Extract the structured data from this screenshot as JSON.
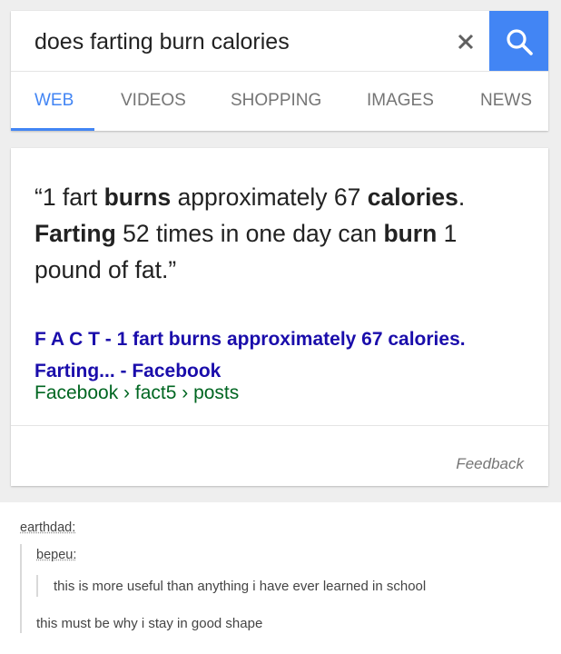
{
  "search": {
    "query": "does farting burn calories",
    "clear_symbol": "×"
  },
  "tabs": [
    {
      "label": "WEB",
      "active": true
    },
    {
      "label": "VIDEOS",
      "active": false
    },
    {
      "label": "SHOPPING",
      "active": false
    },
    {
      "label": "IMAGES",
      "active": false
    },
    {
      "label": "NEWS",
      "active": false
    }
  ],
  "snippet": {
    "quote_open": "“1 fart ",
    "quote_bold_1": "burns",
    "quote_mid_1": " approximately 67 ",
    "quote_bold_2": "calories",
    "quote_mid_2": ". ",
    "quote_bold_3": "Farting",
    "quote_mid_3": " 52 times in one day can ",
    "quote_bold_4": "burn",
    "quote_end": " 1 pound of fat.”",
    "title_line_1": "F A C T - 1 fart burns approximately 67 calories.",
    "title_line_2": "Farting... - Facebook",
    "url": "Facebook › fact5 › posts",
    "feedback": "Feedback"
  },
  "colors": {
    "accent": "#4285f4",
    "link": "#1a0dab",
    "url": "#006621"
  },
  "post": {
    "poster": "earthdad:",
    "reblog_user": "bepeu:",
    "reblog_text": "this is more useful than anything i have ever learned in school",
    "comment": "this must be why i stay in good shape"
  }
}
